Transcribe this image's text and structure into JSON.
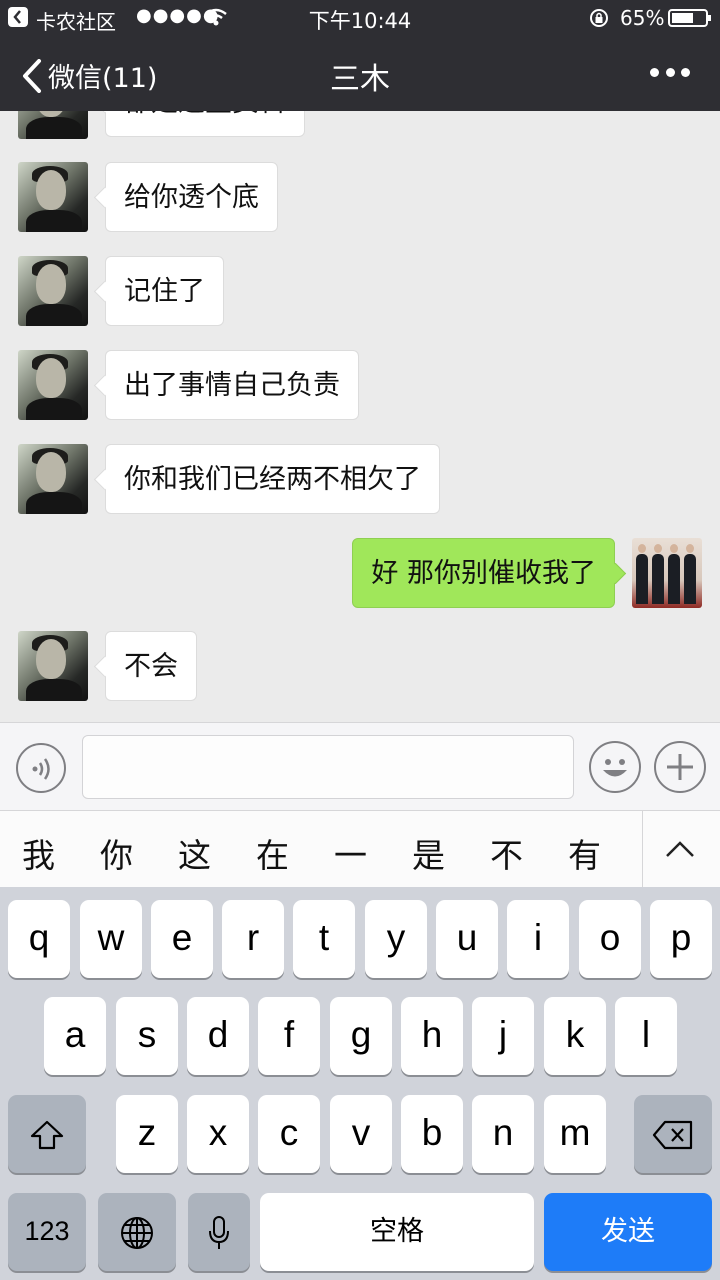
{
  "status_bar": {
    "carrier": "卡农社区",
    "signal_dots": "●●●●●",
    "time": "下午10:44",
    "battery_percent": "65%",
    "battery_level": 0.65
  },
  "nav": {
    "back_label": "微信(11)",
    "title": "三木"
  },
  "messages": [
    {
      "from": "them",
      "text": "都是这些资料"
    },
    {
      "from": "them",
      "text": "给你透个底"
    },
    {
      "from": "them",
      "text": "记住了"
    },
    {
      "from": "them",
      "text": "出了事情自己负责"
    },
    {
      "from": "them",
      "text": "你和我们已经两不相欠了"
    },
    {
      "from": "me",
      "text": "好 那你别催收我了"
    },
    {
      "from": "them",
      "text": "不会"
    }
  ],
  "input": {
    "value": "",
    "placeholder": ""
  },
  "candidates": [
    "我",
    "你",
    "这",
    "在",
    "一",
    "是",
    "不",
    "有"
  ],
  "keyboard": {
    "row1": [
      "q",
      "w",
      "e",
      "r",
      "t",
      "y",
      "u",
      "i",
      "o",
      "p"
    ],
    "row2": [
      "a",
      "s",
      "d",
      "f",
      "g",
      "h",
      "j",
      "k",
      "l"
    ],
    "row3": [
      "z",
      "x",
      "c",
      "v",
      "b",
      "n",
      "m"
    ],
    "numbers_label": "123",
    "space_label": "空格",
    "send_label": "发送"
  },
  "colors": {
    "nav_bg": "#2e2e33",
    "chat_bg": "#ebebeb",
    "my_bubble": "#a0e75a",
    "send_key": "#1e7cf8"
  }
}
